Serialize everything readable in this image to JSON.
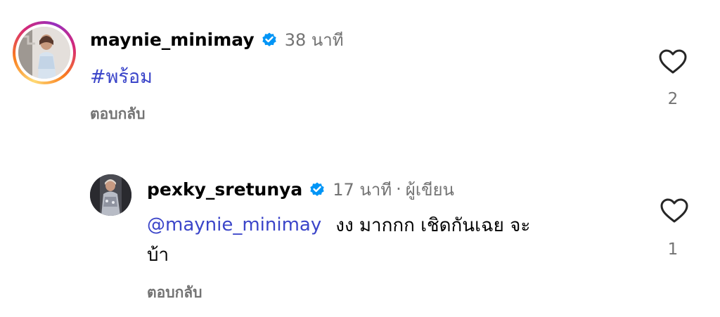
{
  "comment": {
    "username": "maynie_minimay",
    "time": "38 นาที",
    "text": "#พร้อม",
    "reply_label": "ตอบกลับ",
    "likes": "2",
    "avatar_icon": "profile-photo",
    "verified_icon": "verified-badge",
    "like_icon": "heart-outline"
  },
  "reply": {
    "username": "pexky_sretunya",
    "time": "17 นาที",
    "separator": "·",
    "author_label": "ผู้เขียน",
    "mention": "@maynie_minimay",
    "text_line1": "งง มากกก เชิดกันเฉย  จะ",
    "text_line2": "บ้า",
    "reply_label": "ตอบกลับ",
    "likes": "1",
    "avatar_icon": "profile-photo",
    "verified_icon": "verified-badge",
    "like_icon": "heart-outline"
  },
  "colors": {
    "link": "#3b45c9",
    "secondary_text": "#737373",
    "verified": "#0095f6"
  }
}
